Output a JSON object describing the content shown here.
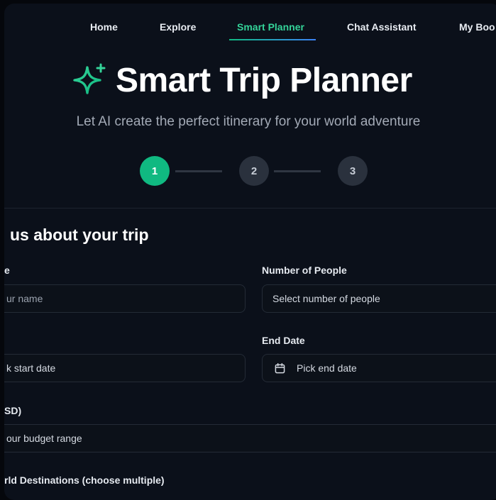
{
  "nav": {
    "items": [
      {
        "label": "Home"
      },
      {
        "label": "Explore"
      },
      {
        "label": "Smart Planner"
      },
      {
        "label": "Chat Assistant"
      },
      {
        "label": "My Boo"
      }
    ],
    "active_index": 2
  },
  "hero": {
    "title": "Smart Trip Planner",
    "subtitle": "Let AI create the perfect itinerary for your world adventure",
    "icon": "sparkle-icon"
  },
  "stepper": {
    "steps": [
      "1",
      "2",
      "3"
    ],
    "current": 1
  },
  "form": {
    "section_title": "us about your trip",
    "name": {
      "label": "e",
      "placeholder": "ur name"
    },
    "people": {
      "label": "Number of People",
      "value": "Select number of people"
    },
    "start_date": {
      "placeholder": "k start date"
    },
    "end_date": {
      "label": "End Date",
      "placeholder": "Pick end date",
      "icon": "calendar-icon"
    },
    "budget": {
      "label": "SD)",
      "placeholder": "our budget range"
    },
    "destinations": {
      "label": "rld Destinations (choose multiple)"
    }
  },
  "colors": {
    "accent": "#10b981",
    "accent_text": "#34d399",
    "background": "#0b101a",
    "step_inactive": "#2a313d"
  }
}
